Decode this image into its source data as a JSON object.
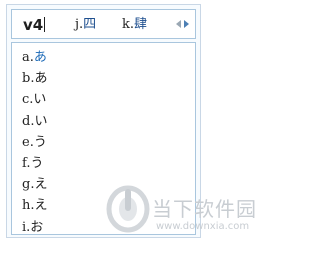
{
  "composition": {
    "input": "v4",
    "candidates": [
      {
        "key": "j.",
        "value": "四"
      },
      {
        "key": "k.",
        "value": "肆"
      }
    ]
  },
  "list": {
    "items": [
      {
        "key": "a.",
        "value": "あ",
        "highlight": true
      },
      {
        "key": "b.",
        "value": "あ",
        "highlight": false
      },
      {
        "key": "c.",
        "value": "い",
        "highlight": false
      },
      {
        "key": "d.",
        "value": "い",
        "highlight": false
      },
      {
        "key": "e.",
        "value": "う",
        "highlight": false
      },
      {
        "key": "f.",
        "value": "う",
        "highlight": false
      },
      {
        "key": "g.",
        "value": "え",
        "highlight": false
      },
      {
        "key": "h.",
        "value": "え",
        "highlight": false
      },
      {
        "key": "i.",
        "value": "お",
        "highlight": false
      }
    ]
  },
  "watermark": {
    "title": "当下软件园",
    "url": "www.downxia.com"
  },
  "colors": {
    "frame_border": "#a9c6de",
    "candidate_text": "#1e4f8f",
    "highlight_text": "#1e6bb8"
  }
}
